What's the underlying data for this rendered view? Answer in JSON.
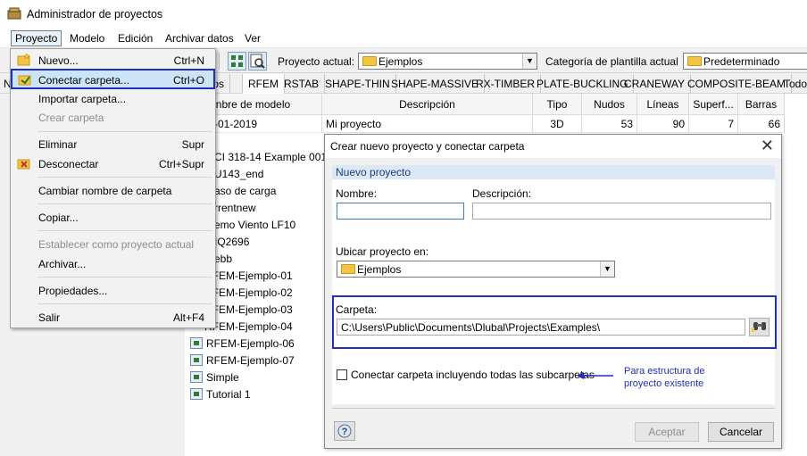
{
  "window": {
    "title": "Administrador de proyectos"
  },
  "menubar": [
    "Proyecto",
    "Modelo",
    "Edición",
    "Archivar datos",
    "Ver"
  ],
  "toolbar": {
    "proyecto_label": "Proyecto actual:",
    "proyecto_value": "Ejemplos",
    "categoria_label": "Categoría de plantilla actual",
    "categoria_value": "Predeterminado"
  },
  "tabs": [
    "ctos",
    "RFEM",
    "RSTAB",
    "SHAPE-THIN",
    "SHAPE-MASSIVE",
    "RX-TIMBER",
    "PLATE-BUCKLING",
    "CRANEWAY",
    "COMPOSITE-BEAM",
    "Todo"
  ],
  "grid": {
    "columns": [
      "nbre de modelo",
      "Descripción",
      "Tipo",
      "Nudos",
      "Líneas",
      "Superf...",
      "Barras"
    ],
    "first_row": {
      "date": "-01-2019",
      "descripcion": "Mi proyecto",
      "tipo": "3D",
      "nudos": "53",
      "lineas": "90",
      "superf": "7",
      "barras": "66"
    },
    "items": [
      "CI 318-14 Example 001",
      "U143_end",
      "aso de carga",
      "rrentnew",
      "emo Viento LF10",
      "IQ2696",
      "ebb",
      "RFEM-Ejemplo-01",
      "RFEM-Ejemplo-02",
      "RFEM-Ejemplo-03",
      "RFEM-Ejemplo-04",
      "RFEM-Ejemplo-06",
      "RFEM-Ejemplo-07",
      "Simple",
      "Tutorial 1"
    ]
  },
  "left_partial": {
    "n": "N"
  },
  "dropdown": {
    "items": [
      {
        "label": "Nuevo...",
        "shortcut": "Ctrl+N",
        "disabled": false
      },
      {
        "label": "Conectar carpeta...",
        "shortcut": "Ctrl+O",
        "disabled": false
      },
      {
        "label": "Importar carpeta...",
        "shortcut": "",
        "disabled": false
      },
      {
        "label": "Crear carpeta",
        "shortcut": "",
        "disabled": true
      },
      {
        "label": "Eliminar",
        "shortcut": "Supr",
        "disabled": false
      },
      {
        "label": "Desconectar",
        "shortcut": "Ctrl+Supr",
        "disabled": false
      },
      {
        "label": "Cambiar nombre de carpeta",
        "shortcut": "",
        "disabled": false
      },
      {
        "label": "Copiar...",
        "shortcut": "",
        "disabled": false
      },
      {
        "label": "Establecer como proyecto actual",
        "shortcut": "",
        "disabled": true
      },
      {
        "label": "Archivar...",
        "shortcut": "",
        "disabled": false
      },
      {
        "label": "Propiedades...",
        "shortcut": "",
        "disabled": false
      },
      {
        "label": "Salir",
        "shortcut": "Alt+F4",
        "disabled": false
      }
    ]
  },
  "dialog": {
    "title": "Crear nuevo proyecto y conectar carpeta",
    "group": "Nuevo proyecto",
    "nombre_label": "Nombre:",
    "nombre_value": "",
    "descripcion_label": "Descripción:",
    "descripcion_value": "",
    "ubicar_label": "Ubicar proyecto en:",
    "ubicar_value": "Ejemplos",
    "carpeta_label": "Carpeta:",
    "carpeta_value": "C:\\Users\\Public\\Documents\\Dlubal\\Projects\\Examples\\",
    "checkbox_label": "Conectar carpeta incluyendo todas las subcarpetas",
    "checkbox_checked": false,
    "annotation": "Para estructura de proyecto existente",
    "aceptar": "Aceptar",
    "cancelar": "Cancelar",
    "help": "?"
  },
  "colors": {
    "highlight": "#1f2fbf",
    "menu_selected": "#cce4f7",
    "annotation": "#1f2fbf"
  }
}
